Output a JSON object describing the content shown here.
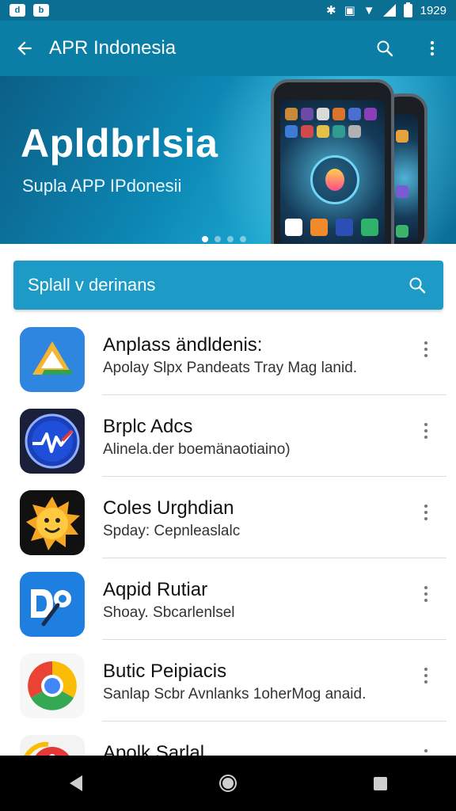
{
  "status_bar": {
    "time": "1929",
    "notification_icons": [
      "d-icon",
      "b-icon"
    ]
  },
  "app_bar": {
    "title": "APR Indonesia",
    "icons": [
      "arrow-back-icon",
      "search-icon",
      "more-vert-icon"
    ]
  },
  "banner": {
    "title": "Apldbrlsia",
    "subtitle": "Supla APP IPdonesii",
    "page_count": 4,
    "active_page": 1
  },
  "search": {
    "placeholder": "Splall v derinans"
  },
  "apps": [
    {
      "name": "Anplass ändldenis:",
      "description": "Apolay Slpx Pandeats Tray Mag lanid.",
      "icon": "triangle-app-icon"
    },
    {
      "name": "Brplc Adcs",
      "description": "Alinela.der boemänaotiaino)",
      "icon": "pulse-app-icon"
    },
    {
      "name": "Coles Urghdian",
      "description": "Spday: Cepnleaslalc",
      "icon": "sun-app-icon"
    },
    {
      "name": "Aqpid Rutiar",
      "description": "Shoay. Sbcarlenlsel",
      "icon": "dp-app-icon"
    },
    {
      "name": "Butic Peipiacis",
      "description": "Sanlap Scbr Avnlanks 1oherMog anaid.",
      "icon": "chrome-app-icon"
    },
    {
      "name": "Apolk Sarlal",
      "description": "",
      "icon": "red-app-icon"
    }
  ],
  "nav_bar": {
    "icons": [
      "back-triangle-icon",
      "home-circle-icon",
      "recents-square-icon"
    ]
  },
  "colors": {
    "app_bar": "#0a7ea5",
    "status_bar": "#0a6f92",
    "search_bar": "#1d9ac6"
  }
}
